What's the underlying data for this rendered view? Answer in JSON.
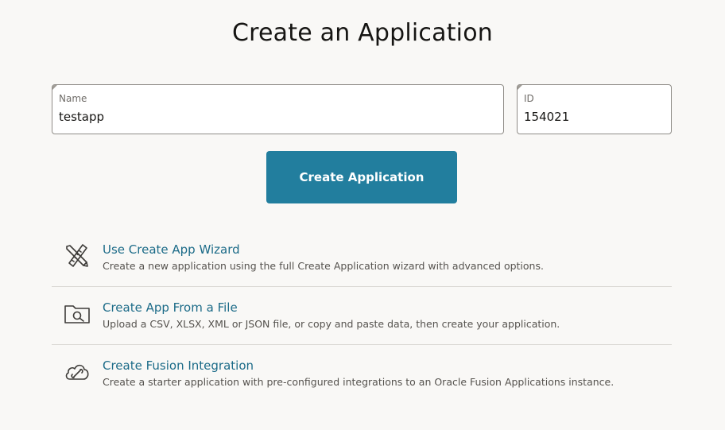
{
  "page": {
    "title": "Create an Application"
  },
  "form": {
    "name_label": "Name",
    "name_value": "testapp",
    "id_label": "ID",
    "id_value": "154021",
    "create_button_label": "Create Application"
  },
  "options": [
    {
      "icon": "pencil-ruler-icon",
      "title": "Use Create App Wizard",
      "description": "Create a new application using the full Create Application wizard with advanced options."
    },
    {
      "icon": "folder-search-icon",
      "title": "Create App From a File",
      "description": "Upload a CSV, XLSX, XML or JSON file, or copy and paste data, then create your application."
    },
    {
      "icon": "cloud-link-icon",
      "title": "Create Fusion Integration",
      "description": "Create a starter application with pre-configured integrations to an Oracle Fusion Applications instance."
    }
  ],
  "colors": {
    "background": "#f9f8f6",
    "primary_button": "#227e9e",
    "link": "#1c6b88"
  }
}
